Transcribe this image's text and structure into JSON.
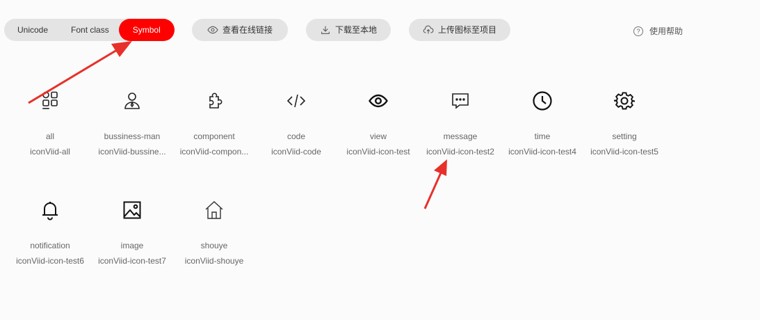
{
  "tabs": [
    {
      "label": "Unicode",
      "active": false
    },
    {
      "label": "Font class",
      "active": false
    },
    {
      "label": "Symbol",
      "active": true
    }
  ],
  "actions": {
    "view_online": "查看在线链接",
    "download": "下载至本地",
    "upload": "上传图标至项目"
  },
  "help": {
    "label": "使用帮助",
    "icon_text": "?"
  },
  "icons": [
    {
      "name": "all",
      "code": "iconViid-all",
      "icon": "grid-icon"
    },
    {
      "name": "bussiness-man",
      "code": "iconViid-bussine...",
      "icon": "business-man-icon"
    },
    {
      "name": "component",
      "code": "iconViid-compon...",
      "icon": "puzzle-icon"
    },
    {
      "name": "code",
      "code": "iconViid-code",
      "icon": "code-icon"
    },
    {
      "name": "view",
      "code": "iconViid-icon-test",
      "icon": "eye-icon"
    },
    {
      "name": "message",
      "code": "iconViid-icon-test2",
      "icon": "message-icon"
    },
    {
      "name": "time",
      "code": "iconViid-icon-test4",
      "icon": "clock-icon"
    },
    {
      "name": "setting",
      "code": "iconViid-icon-test5",
      "icon": "gear-icon"
    },
    {
      "name": "notification",
      "code": "iconViid-icon-test6",
      "icon": "bell-icon"
    },
    {
      "name": "image",
      "code": "iconViid-icon-test7",
      "icon": "image-icon"
    },
    {
      "name": "shouye",
      "code": "iconViid-shouye",
      "icon": "home-icon"
    }
  ],
  "colors": {
    "accent": "#ff0000",
    "pill_bg": "#e4e4e4",
    "annotation_arrow": "#e8302a"
  }
}
